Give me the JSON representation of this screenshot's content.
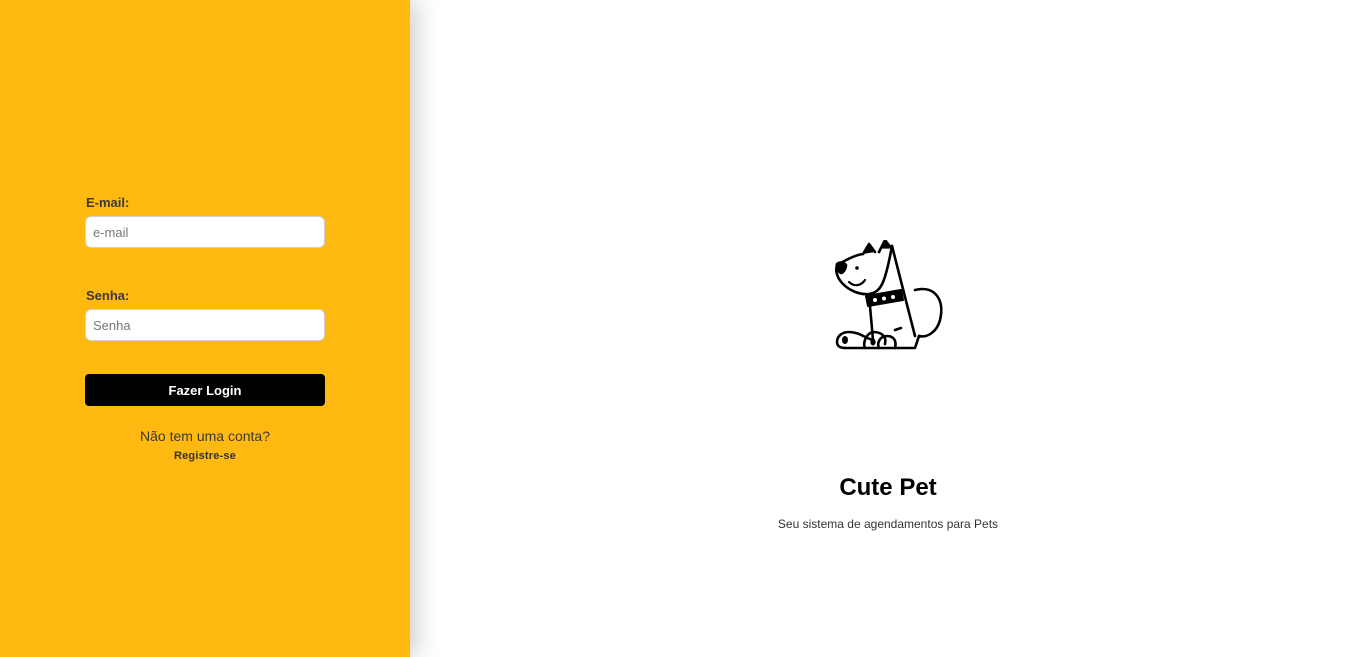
{
  "login": {
    "email_label": "E-mail:",
    "email_placeholder": "e-mail",
    "email_value": "",
    "password_label": "Senha:",
    "password_placeholder": "Senha",
    "password_value": "",
    "submit_label": "Fazer Login",
    "signup_question": "Não tem uma conta?",
    "signup_link": "Registre-se"
  },
  "brand": {
    "logo_icon": "dog-icon",
    "title": "Cute Pet",
    "subtitle": "Seu sistema de agendamentos para Pets"
  },
  "colors": {
    "accent": "#FFB911",
    "button": "#000000",
    "background": "#ffffff"
  }
}
